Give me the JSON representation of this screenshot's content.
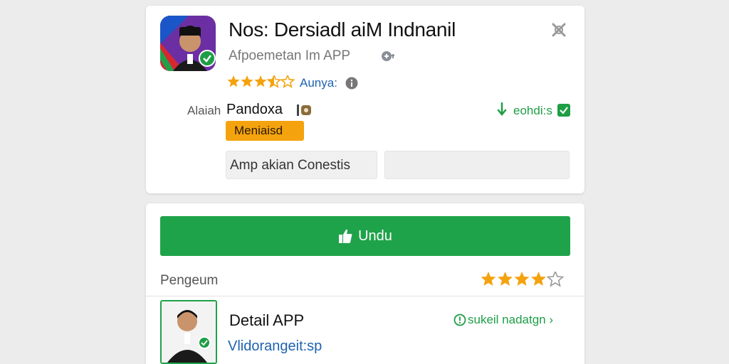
{
  "app": {
    "title": "Nos: Dersiadl aiM Indnanil",
    "subtitle": "Afpoemetan Im APP",
    "rating": 3.5,
    "rating_label": "Aunya:",
    "developer_prefix": "Alaiah",
    "developer_name": "Pandoxa",
    "download_status": "eohdi:s",
    "badge_label": "Meniaisd",
    "field_value": "Amp akian Conestis"
  },
  "install": {
    "button_label": "Undu",
    "review_label": "Pengeum",
    "review_rating": 4
  },
  "detail": {
    "title": "Detail APP",
    "link_label": "sukeil nadatgn",
    "subtitle": "Vlidorangeit:sp"
  },
  "colors": {
    "accent_green": "#1fa34a",
    "star_orange": "#f4a30f",
    "link_blue": "#1e63b0"
  },
  "icons": {
    "close": "close-icon",
    "info": "info-icon",
    "verify": "check-badge-icon",
    "install": "thumb-icon",
    "download": "down-arrow-icon"
  }
}
